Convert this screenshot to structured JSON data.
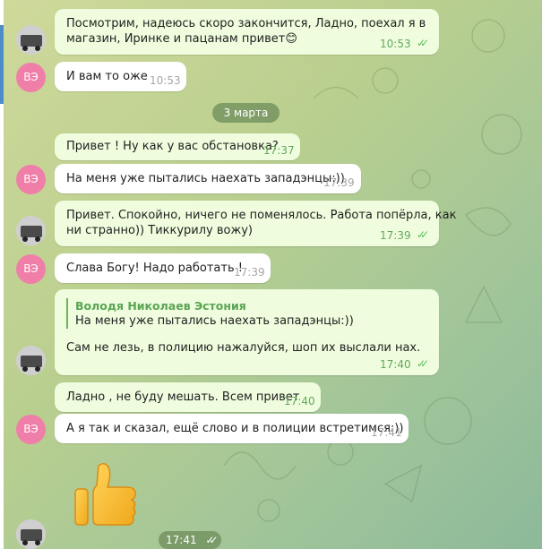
{
  "date_separator": "3 марта",
  "avatar_initials": "ВЭ",
  "messages": [
    {
      "text_line1": "Посмотрим, надеюсь скоро закончится, Ладно, поехал я в",
      "text_line2": "магазин, Иринке и пацанам привет",
      "emoji": "😊",
      "time": "10:53",
      "read": "✓✓"
    },
    {
      "text": "И вам то оже",
      "time": "10:53"
    },
    {
      "text": "Привет ! Ну как у вас обстановка?",
      "time": "17:37"
    },
    {
      "text": "На меня уже пытались наехать западэнцы:))",
      "time": "17:39"
    },
    {
      "text_line1": "Привет. Спокойно, ничего не поменялось. Работа попёрла, как",
      "text_line2": "ни странно))  Тиккурилу вожу)",
      "time": "17:39",
      "read": "✓✓"
    },
    {
      "text": "Слава Богу! Надо работать  !",
      "time": "17:39"
    },
    {
      "quote_name": "Володя Николаев Эстония",
      "quote_text": "На меня уже пытались наехать западэнцы:))",
      "text": "Сам не лезь, в полицию нажалуйся, шоп их выслали нах.",
      "time": "17:40",
      "read": "✓✓"
    },
    {
      "text": "Ладно , не буду мешать. Всем привет",
      "time": "17:40"
    },
    {
      "text": "А я так и сказал, ещё слово и в полиции встретимся:))",
      "time": "17:41"
    },
    {
      "sticker": "thumbs-up",
      "time": "17:41",
      "read": "✓✓"
    }
  ],
  "colors": {
    "bubble_out": "#effdde",
    "bubble_in": "#ffffff",
    "avatar_ve": "#ef7fa9",
    "accent_green": "#5aa553"
  }
}
